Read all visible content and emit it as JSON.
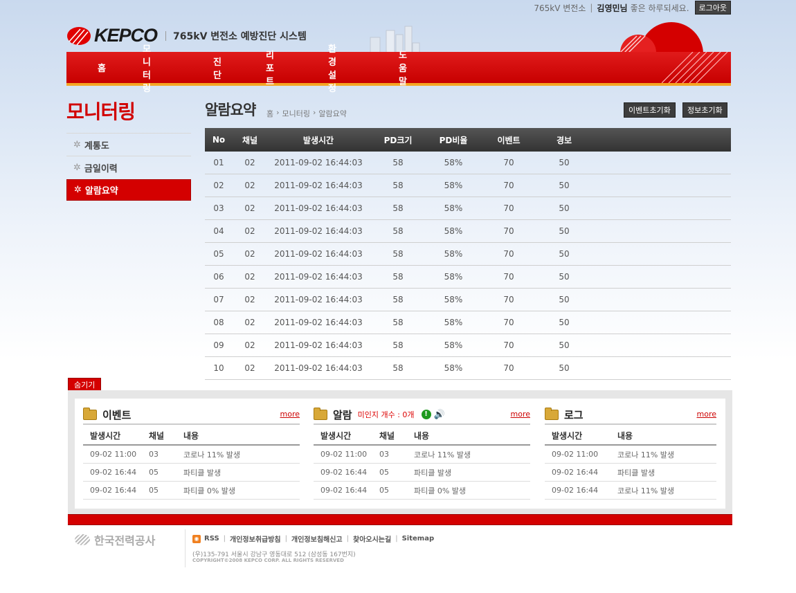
{
  "topbar": {
    "station": "765kV 변전소",
    "user_name": "김영민님",
    "greeting": "좋은 하루되세요.",
    "logout_label": "로그아웃"
  },
  "logo": {
    "brand": "KEPCO",
    "system_name": "765kV 변전소 예방진단 시스템"
  },
  "nav": {
    "items": [
      "홈",
      "모니터링",
      "진단",
      "리포트",
      "환경설정",
      "도움말"
    ]
  },
  "sidebar": {
    "title": "모니터링",
    "items": [
      {
        "label": "계통도"
      },
      {
        "label": "금일이력"
      },
      {
        "label": "알람요약"
      }
    ],
    "active_index": 2
  },
  "content": {
    "page_title": "알람요약",
    "breadcrumb": [
      "홈",
      "모니터링",
      "알람요약"
    ],
    "buttons": {
      "event_reset": "이벤트초기화",
      "info_reset": "정보초기화"
    },
    "table": {
      "headers": [
        "No",
        "채널",
        "발생시간",
        "PD크기",
        "PD비율",
        "이벤트",
        "경보"
      ],
      "rows": [
        [
          "01",
          "02",
          "2011-09-02 16:44:03",
          "58",
          "58%",
          "70",
          "50"
        ],
        [
          "02",
          "02",
          "2011-09-02 16:44:03",
          "58",
          "58%",
          "70",
          "50"
        ],
        [
          "03",
          "02",
          "2011-09-02 16:44:03",
          "58",
          "58%",
          "70",
          "50"
        ],
        [
          "04",
          "02",
          "2011-09-02 16:44:03",
          "58",
          "58%",
          "70",
          "50"
        ],
        [
          "05",
          "02",
          "2011-09-02 16:44:03",
          "58",
          "58%",
          "70",
          "50"
        ],
        [
          "06",
          "02",
          "2011-09-02 16:44:03",
          "58",
          "58%",
          "70",
          "50"
        ],
        [
          "07",
          "02",
          "2011-09-02 16:44:03",
          "58",
          "58%",
          "70",
          "50"
        ],
        [
          "08",
          "02",
          "2011-09-02 16:44:03",
          "58",
          "58%",
          "70",
          "50"
        ],
        [
          "09",
          "02",
          "2011-09-02 16:44:03",
          "58",
          "58%",
          "70",
          "50"
        ],
        [
          "10",
          "02",
          "2011-09-02 16:44:03",
          "58",
          "58%",
          "70",
          "50"
        ]
      ]
    },
    "hide_label": "숨기기"
  },
  "panels": {
    "event": {
      "title": "이벤트",
      "more": "more",
      "headers": [
        "발생시간",
        "채널",
        "내용"
      ],
      "rows": [
        [
          "09-02  11:00",
          "03",
          "코로나 11% 발생"
        ],
        [
          "09-02  16:44",
          "05",
          "파티클 발생"
        ],
        [
          "09-02  16:44",
          "05",
          "파티클 0% 발생"
        ]
      ]
    },
    "alarm": {
      "title": "알람",
      "unread": "미인지 개수 : 0개",
      "more": "more",
      "headers": [
        "발생시간",
        "채널",
        "내용"
      ],
      "rows": [
        [
          "09-02  11:00",
          "03",
          "코로나 11% 발생"
        ],
        [
          "09-02  16:44",
          "05",
          "파티클 발생"
        ],
        [
          "09-02  16:44",
          "05",
          "파티클 0% 발생"
        ]
      ]
    },
    "log": {
      "title": "로그",
      "more": "more",
      "headers": [
        "발생시간",
        "내용"
      ],
      "rows": [
        [
          "09-02  11:00",
          "코로나 11% 발생"
        ],
        [
          "09-02  16:44",
          "파티클 발생"
        ],
        [
          "09-02  16:44",
          "코로나 11% 발생"
        ]
      ]
    }
  },
  "footer": {
    "company": "한국전력공사",
    "links": [
      "RSS",
      "개인정보취급방침",
      "개인정보침해신고",
      "찾아오시는길",
      "Sitemap"
    ],
    "address": "(우)135-791 서울시 강남구 영동대로 512 (삼성동 167번지)",
    "copyright": "COPYRIGHT©2008 KEPCO CORP. ALL RIGHTS RESERVED"
  },
  "colors": {
    "brand_red": "#d40000",
    "accent_orange": "#f5a623",
    "table_header": "#3d3d3d",
    "more_link": "#cc0000"
  }
}
